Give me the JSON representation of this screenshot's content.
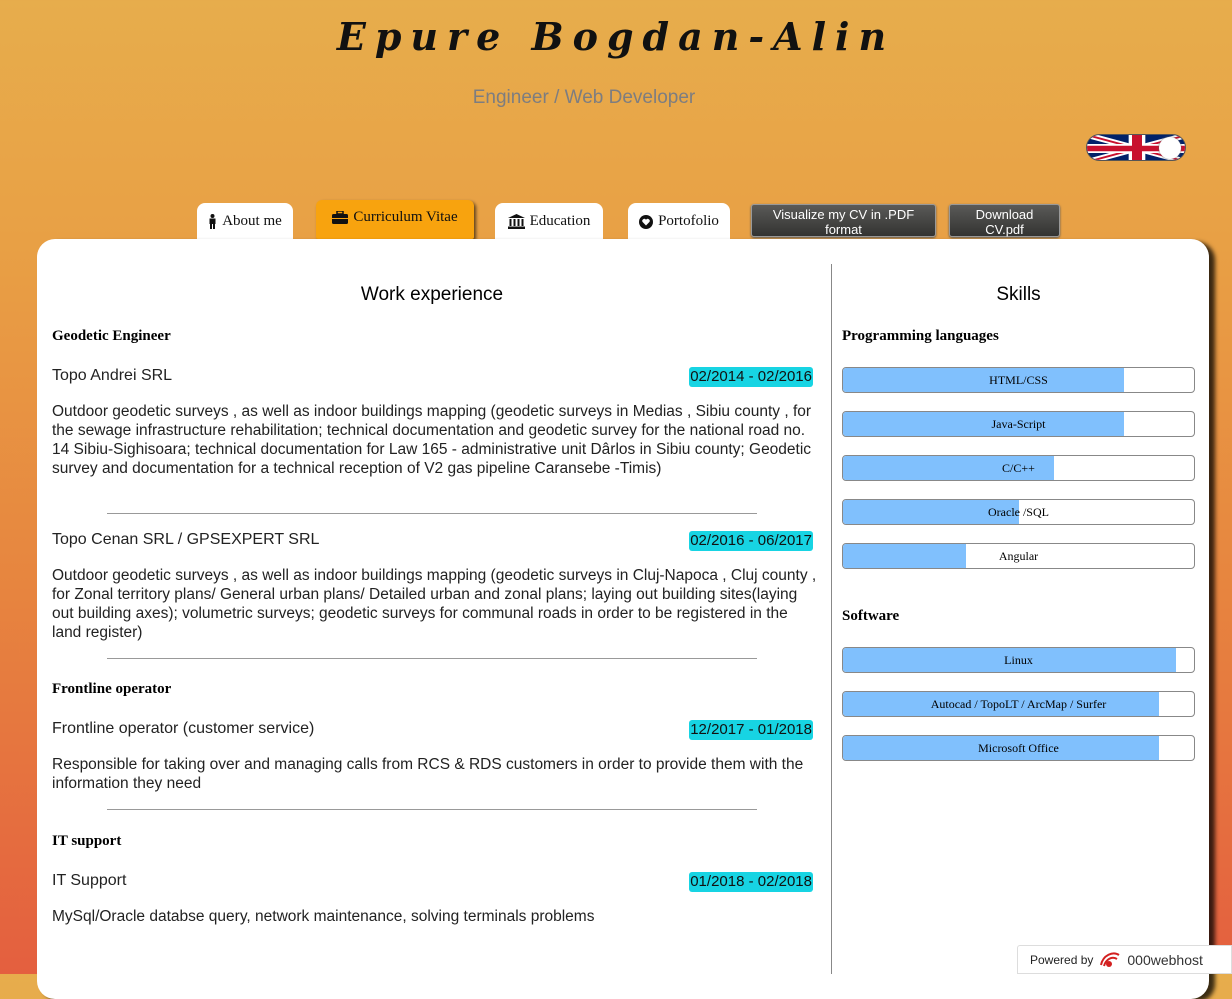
{
  "header": {
    "name": "Epure Bogdan-Alin",
    "subtitle": "Engineer / Web Developer"
  },
  "language_toggle": {
    "flag": "uk-flag-icon",
    "state": "on"
  },
  "tabs": [
    {
      "label": "About me",
      "icon": "person-icon",
      "active": false
    },
    {
      "label": "Curriculum Vitae",
      "icon": "briefcase-icon",
      "active": true
    },
    {
      "label": "Education",
      "icon": "bank-icon",
      "active": false
    },
    {
      "label": "Portofolio",
      "icon": "heart-icon",
      "active": false
    }
  ],
  "buttons": {
    "pdf_view_line1": "Visualize my CV in .PDF",
    "pdf_view_line2": "format",
    "download_line1": "Download",
    "download_line2": "CV.pdf"
  },
  "work": {
    "title": "Work experience",
    "groups": [
      {
        "role": "Geodetic Engineer",
        "entries": [
          {
            "company": "Topo Andrei SRL",
            "date": "02/2014 - 02/2016",
            "description": "Outdoor geodetic surveys , as well as indoor buildings mapping (geodetic surveys in Medias , Sibiu county , for the sewage infrastructure rehabilitation; technical documentation and geodetic survey for the national road no. 14 Sibiu-Sighisoara; technical documentation for Law 165 - administrative unit Dârlos in Sibiu county; Geodetic survey and documentation for a technical reception of V2 gas pipeline Caransebe -Timis)"
          },
          {
            "company": "Topo Cenan SRL / GPSEXPERT SRL",
            "date": "02/2016 - 06/2017",
            "description": "Outdoor geodetic surveys , as well as indoor buildings mapping (geodetic surveys in Cluj-Napoca , Cluj county , for Zonal territory plans/ General urban plans/ Detailed urban and zonal plans; laying out building sites(laying out building axes); volumetric surveys; geodetic surveys for communal roads in order to be registered in the land register)"
          }
        ]
      },
      {
        "role": "Frontline operator",
        "entries": [
          {
            "company": "Frontline operator (customer service)",
            "date": "12/2017 - 01/2018",
            "description": "Responsible for taking over and managing calls from RCS & RDS customers in order to provide them with the information they need"
          }
        ]
      },
      {
        "role": "IT support",
        "entries": [
          {
            "company": "IT Support",
            "date": "01/2018 - 02/2018",
            "description": "MySql/Oracle databse query, network maintenance, solving terminals problems"
          }
        ]
      }
    ]
  },
  "skills": {
    "title": "Skills",
    "programming_title": "Programming languages",
    "programming": [
      {
        "name": "HTML/CSS",
        "level": 0.8
      },
      {
        "name": "Java-Script",
        "level": 0.8
      },
      {
        "name": "C/C++",
        "level": 0.6
      },
      {
        "name": "Oracle /SQL",
        "level": 0.5
      },
      {
        "name": "Angular",
        "level": 0.35
      }
    ],
    "software_title": "Software",
    "software": [
      {
        "name": "Linux",
        "level": 0.95
      },
      {
        "name": "Autocad / TopoLT / ArcMap / Surfer",
        "level": 0.9
      },
      {
        "name": "Microsoft Office",
        "level": 0.9
      }
    ],
    "bar_color": "#80c0fd"
  },
  "footer": {
    "powered_by": "Powered by",
    "brand": "000webhost"
  }
}
